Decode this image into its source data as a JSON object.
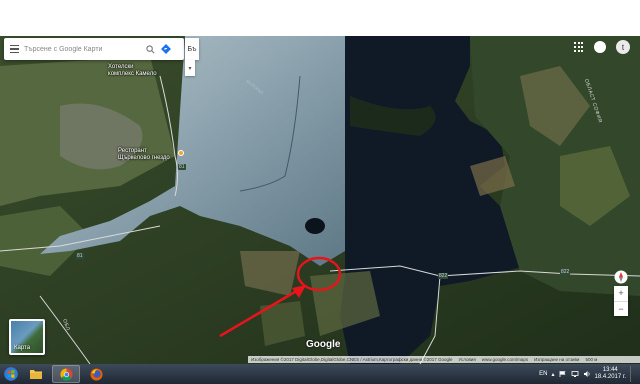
{
  "search": {
    "placeholder": "Търсене с Google Карти"
  },
  "lang_button": "Бъ",
  "account": {
    "notification_count": "",
    "avatar_letter": "t"
  },
  "map_labels": {
    "hotel": "Хотелски\nкомплекс Камело",
    "restaurant": "Ресторант\nЩъркелово гнездо",
    "road_81a": "81",
    "road_81b": "81",
    "road_81c": "81",
    "road_822": "822",
    "road_822b": "822",
    "water": "яз.Искър",
    "region": "ОБЛАСТ СОФИЯ",
    "region_bottom": "ОБЛ"
  },
  "satellite_toggle": "Карта",
  "google_logo": "Google",
  "attribution": {
    "imagery": "Изображения ©2017 DigitalGlobe,DigitalGlobe,CNES / Astrium,Картографски данни ©2017 Google",
    "terms": "Условия",
    "url": "www.google.com/maps",
    "feedback": "Изпращане на отзиви",
    "scale": "500 м"
  },
  "taskbar": {
    "language": "EN",
    "time": "13:44",
    "date": "18.4.2017 г."
  },
  "colors": {
    "water_dark": "#0f1a26",
    "water_light": "#8fa8b5",
    "forest": "#2a3d22",
    "arrow": "#e8141b"
  }
}
